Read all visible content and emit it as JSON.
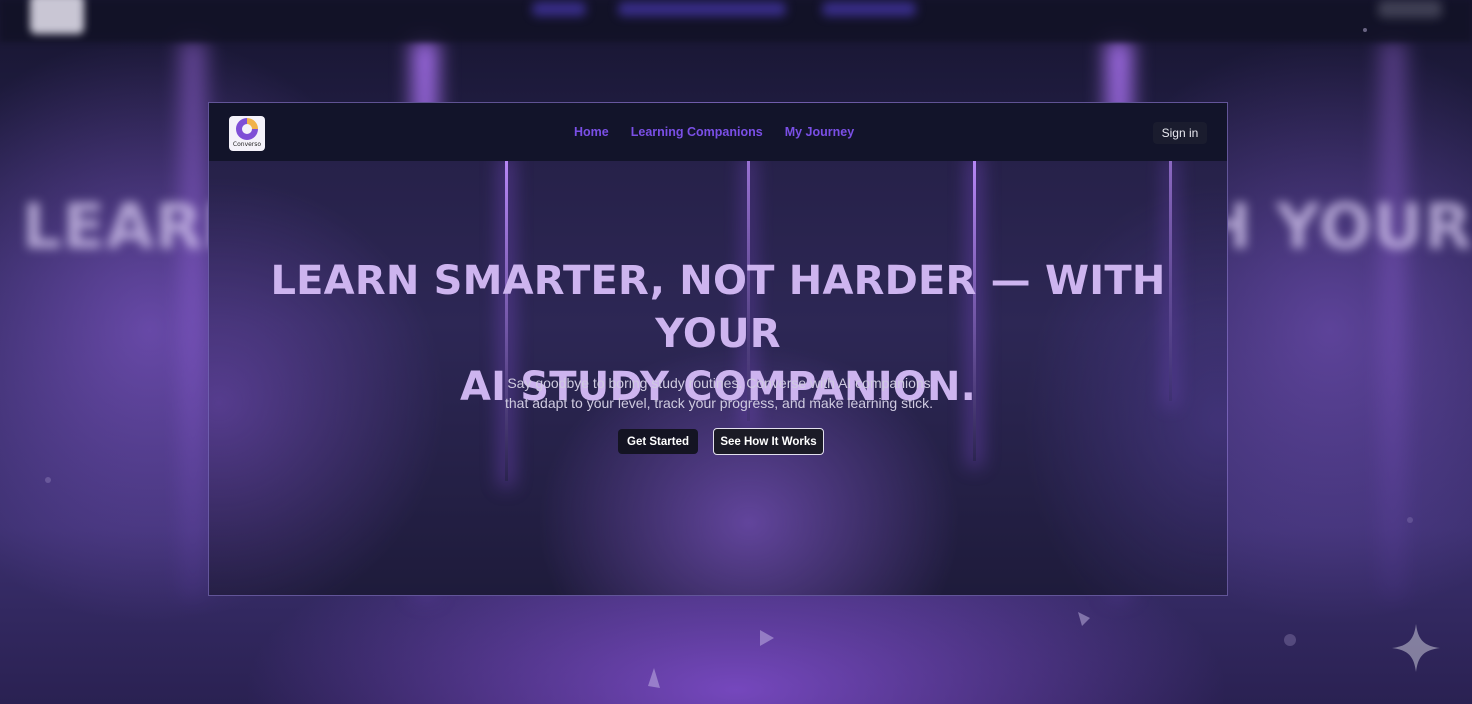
{
  "backdrop": {
    "heading_left": "LEARN",
    "heading_right": "H YOUR"
  },
  "navbar": {
    "logo_text": "Converso",
    "links": [
      "Home",
      "Learning Companions",
      "My Journey"
    ],
    "sign_in": "Sign in"
  },
  "hero": {
    "title_line1": "LEARN SMARTER, NOT HARDER — WITH YOUR",
    "title_line2": "AI STUDY COMPANION.",
    "subtitle_line1": "Say goodbye to boring study routines. Converse with AI companions",
    "subtitle_line2": "that adapt to your level, track your progress, and make learning stick.",
    "primary_button": "Get Started",
    "secondary_button": "See How It Works"
  },
  "colors": {
    "nav_link": "#7a4fe6",
    "heading": "#cdb4ef",
    "navbar_bg": "#12142a"
  },
  "icons": {
    "corner": "sparkle-icon",
    "logo": "logo-c-icon"
  }
}
